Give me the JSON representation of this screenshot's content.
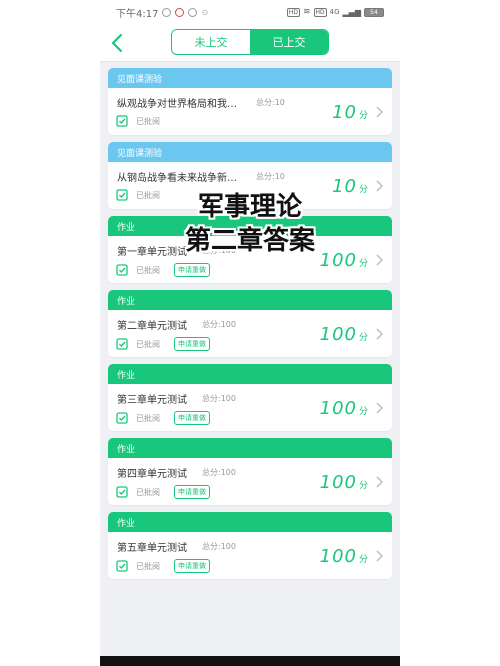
{
  "status_bar": {
    "time": "下午4:17",
    "badges": [
      "HD",
      "HD"
    ],
    "network": "4G",
    "battery": "54"
  },
  "nav": {
    "tabs": [
      {
        "label": "未上交",
        "active": false
      },
      {
        "label": "已上交",
        "active": true
      }
    ]
  },
  "colors": {
    "accent": "#18c77b",
    "blue_header": "#6cc7f0",
    "background": "#eef0f3"
  },
  "items": [
    {
      "header": "见面课测验",
      "header_color": "blue",
      "title": "纵观战争对世界格局和我…",
      "total": "总分:10",
      "status": "已批阅",
      "redo": "",
      "score": "10",
      "unit": "分"
    },
    {
      "header": "见面课测验",
      "header_color": "blue",
      "title": "从钢岛战争看未来战争新…",
      "total": "总分:10",
      "status": "已批阅",
      "redo": "",
      "score": "10",
      "unit": "分"
    },
    {
      "header": "作业",
      "header_color": "green",
      "title": "第一章单元测试",
      "total": "总分:100",
      "status": "已批阅",
      "redo": "申请重做",
      "score": "100",
      "unit": "分"
    },
    {
      "header": "作业",
      "header_color": "green",
      "title": "第二章单元测试",
      "total": "总分:100",
      "status": "已批阅",
      "redo": "申请重做",
      "score": "100",
      "unit": "分"
    },
    {
      "header": "作业",
      "header_color": "green",
      "title": "第三章单元测试",
      "total": "总分:100",
      "status": "已批阅",
      "redo": "申请重做",
      "score": "100",
      "unit": "分"
    },
    {
      "header": "作业",
      "header_color": "green",
      "title": "第四章单元测试",
      "total": "总分:100",
      "status": "已批阅",
      "redo": "申请重做",
      "score": "100",
      "unit": "分"
    },
    {
      "header": "作业",
      "header_color": "green",
      "title": "第五章单元测试",
      "total": "总分:100",
      "status": "已批阅",
      "redo": "申请重做",
      "score": "100",
      "unit": "分"
    }
  ],
  "overlay": {
    "line1": "军事理论",
    "line2": "第二章答案"
  }
}
